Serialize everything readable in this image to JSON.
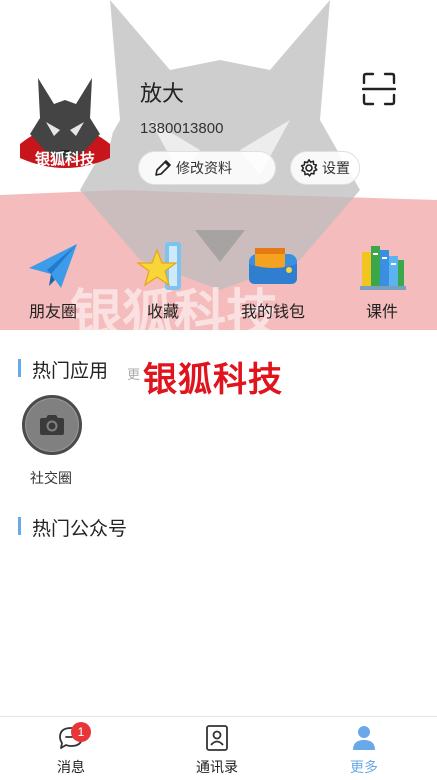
{
  "profile": {
    "name": "放大",
    "phone": "1380013800",
    "avatar_text": "银狐科技",
    "edit_label": "修改资料",
    "settings_label": "设置"
  },
  "header": {
    "scan_icon": "scan-icon"
  },
  "shortcuts": [
    {
      "label": "朋友圈",
      "icon": "paper-plane-icon"
    },
    {
      "label": "收藏",
      "icon": "star-icon"
    },
    {
      "label": "我的钱包",
      "icon": "wallet-icon"
    },
    {
      "label": "课件",
      "icon": "books-icon"
    }
  ],
  "hot_apps": {
    "title": "热门应用",
    "more": "更",
    "items": [
      {
        "label": "社交圈",
        "icon": "camera-icon"
      }
    ]
  },
  "brand_overlay": "银狐科技",
  "hot_accounts": {
    "title": "热门公众号"
  },
  "tabbar": {
    "items": [
      {
        "label": "消息",
        "icon": "chat-bubble-icon",
        "badge": "1",
        "active": false
      },
      {
        "label": "通讯录",
        "icon": "contacts-icon",
        "active": false
      },
      {
        "label": "更多",
        "icon": "person-icon",
        "active": true
      }
    ]
  },
  "colors": {
    "accent": "#6aa9e9",
    "brand_red": "#e0141c",
    "badge_red": "#e8353a"
  }
}
